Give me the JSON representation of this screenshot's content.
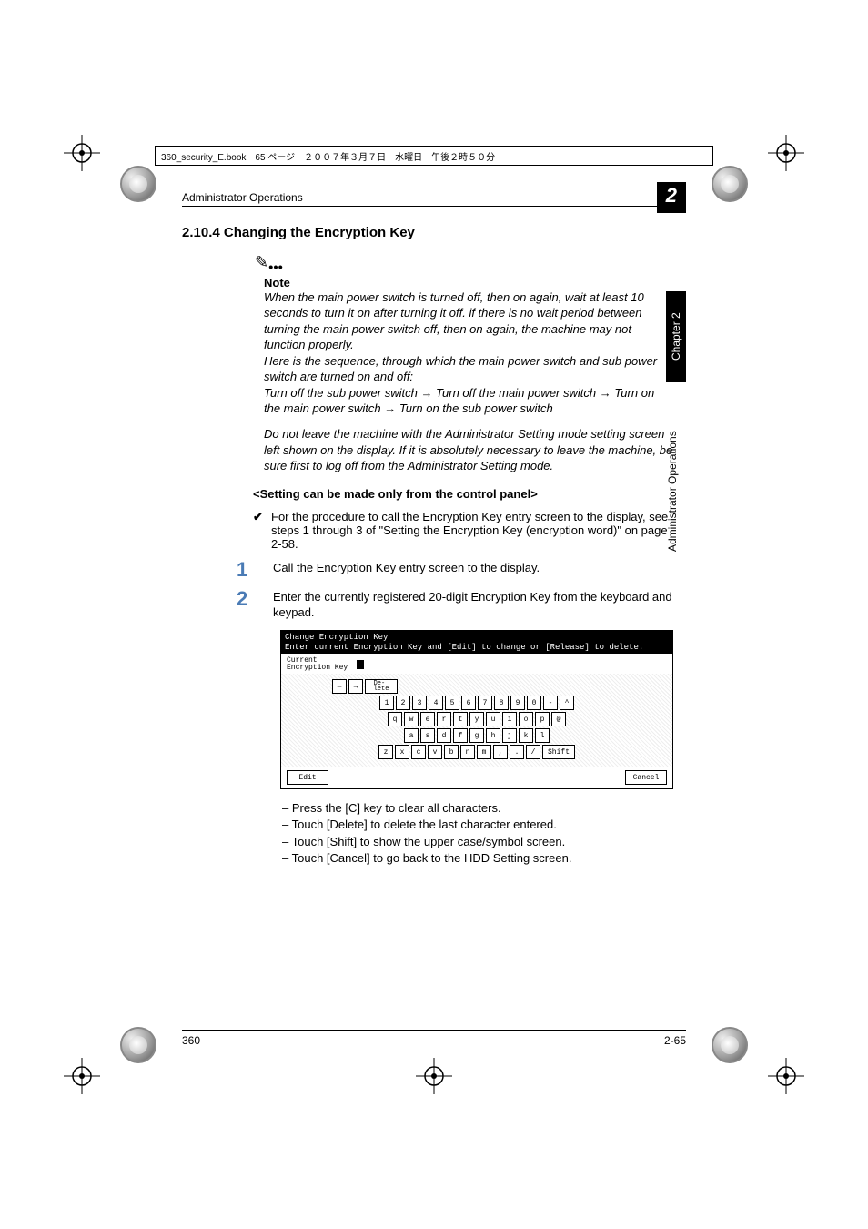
{
  "file_header": "360_security_E.book　65 ページ　２００７年３月７日　水曜日　午後２時５０分",
  "running_head": "Administrator Operations",
  "chapter_num": "2",
  "section_heading": "2.10.4  Changing the Encryption Key",
  "note_label": "Note",
  "note_para1": "When the main power switch is turned off, then on again, wait at least 10 seconds to turn it on after turning it off. if there is no wait period between turning the main power switch off, then on again, the machine may not function properly.",
  "note_para2": "Here is the sequence, through which the main power switch and sub power switch are turned on and off:",
  "note_para3": "Turn off the sub power switch → Turn off the main power switch → Turn on the main power switch → Turn on the sub power switch",
  "note_para4": "Do not leave the machine with the Administrator Setting mode setting screen left shown on the display. If it is absolutely necessary to leave the machine, be sure first to log off from the Administrator Setting mode.",
  "setting_head": "<Setting can be made only from the control panel>",
  "check_para": "For the procedure to call the Encryption Key entry screen to the display, see steps 1 through 3 of \"Setting the Encryption Key (encryption word)\" on page 2-58.",
  "steps": [
    "Call the Encryption Key entry screen to the display.",
    "Enter the currently registered 20-digit Encryption Key from the keyboard and keypad."
  ],
  "panel": {
    "title": "Change Encryption Key",
    "prompt": "Enter current Encryption Key and [Edit] to change or [Release] to delete.",
    "field_label": "Current\nEncryption Key",
    "nav_keys": [
      "←",
      "→",
      "De-\nlete"
    ],
    "row1": [
      "1",
      "2",
      "3",
      "4",
      "5",
      "6",
      "7",
      "8",
      "9",
      "0",
      "-",
      "^"
    ],
    "row2": [
      "q",
      "w",
      "e",
      "r",
      "t",
      "y",
      "u",
      "i",
      "o",
      "p",
      "@"
    ],
    "row3": [
      "a",
      "s",
      "d",
      "f",
      "g",
      "h",
      "j",
      "k",
      "l"
    ],
    "row4": [
      "z",
      "x",
      "c",
      "v",
      "b",
      "n",
      "m",
      ",",
      ".",
      "/"
    ],
    "shift": "Shift",
    "edit": "Edit",
    "cancel": "Cancel"
  },
  "dash_items": [
    "Press the [C] key to clear all characters.",
    "Touch [Delete] to delete the last character entered.",
    "Touch [Shift] to show the upper case/symbol screen.",
    "Touch [Cancel] to go back to the HDD Setting screen."
  ],
  "sidetabs": {
    "black": "Chapter 2",
    "white": "Administrator Operations"
  },
  "footer_left": "360",
  "footer_right": "2-65"
}
